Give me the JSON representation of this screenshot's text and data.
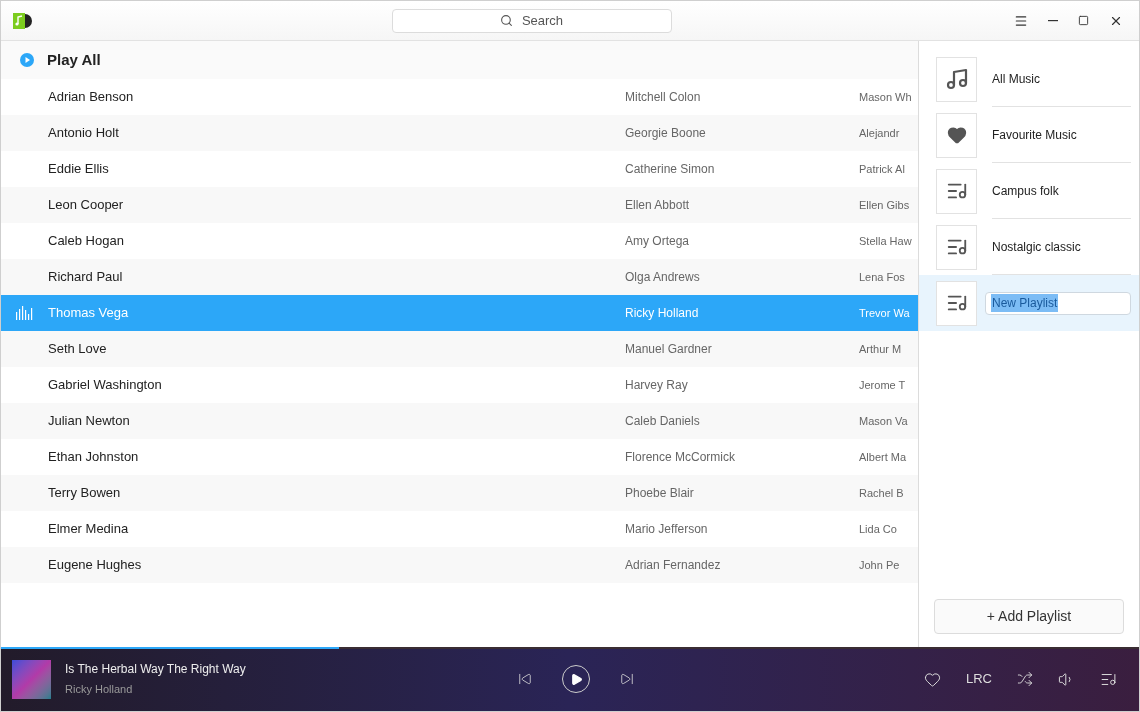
{
  "search": {
    "placeholder": "Search"
  },
  "play_all": "Play All",
  "rows": [
    {
      "title": "Adrian Benson",
      "artist": "Mitchell Colon",
      "column_3": "Mason Wh",
      "selected": false
    },
    {
      "title": "Antonio Holt",
      "artist": "Georgie Boone",
      "column_3": "Alejandr",
      "selected": false
    },
    {
      "title": "Eddie Ellis",
      "artist": "Catherine Simon",
      "column_3": "Patrick Al",
      "selected": false
    },
    {
      "title": "Leon Cooper",
      "artist": "Ellen Abbott",
      "column_3": "Ellen Gibs",
      "selected": false
    },
    {
      "title": "Caleb Hogan",
      "artist": "Amy Ortega",
      "column_3": "Stella Haw",
      "selected": false
    },
    {
      "title": "Richard Paul",
      "artist": "Olga Andrews",
      "column_3": "Lena Fos",
      "selected": false
    },
    {
      "title": "Thomas Vega",
      "artist": "Ricky Holland",
      "column_3": "Trevor Wa",
      "selected": true
    },
    {
      "title": "Seth Love",
      "artist": "Manuel Gardner",
      "column_3": "Arthur M",
      "selected": false
    },
    {
      "title": "Gabriel Washington",
      "artist": "Harvey Ray",
      "column_3": "Jerome T",
      "selected": false
    },
    {
      "title": "Julian Newton",
      "artist": "Caleb Daniels",
      "column_3": "Mason Va",
      "selected": false
    },
    {
      "title": "Ethan Johnston",
      "artist": "Florence McCormick",
      "column_3": "Albert Ma",
      "selected": false
    },
    {
      "title": "Terry Bowen",
      "artist": "Phoebe Blair",
      "column_3": "Rachel B",
      "selected": false
    },
    {
      "title": "Elmer Medina",
      "artist": "Mario Jefferson",
      "column_3": "Lida Co",
      "selected": false
    },
    {
      "title": "Eugene Hughes",
      "artist": "Adrian Fernandez",
      "column_3": "John Pe",
      "selected": false
    }
  ],
  "playlists": [
    {
      "kind": "music",
      "name": "All Music",
      "editing": false
    },
    {
      "kind": "heart",
      "name": "Favourite Music",
      "editing": false
    },
    {
      "kind": "playlist",
      "name": "Campus folk",
      "editing": false
    },
    {
      "kind": "playlist",
      "name": "Nostalgic classic",
      "editing": false
    },
    {
      "kind": "playlist",
      "name": "New Playlist",
      "editing": true
    }
  ],
  "add_playlist": "+ Add Playlist",
  "player": {
    "title": "Is The Herbal Way The Right Way",
    "artist": "Ricky Holland",
    "level": 0.297,
    "lyrics": "LRC"
  }
}
